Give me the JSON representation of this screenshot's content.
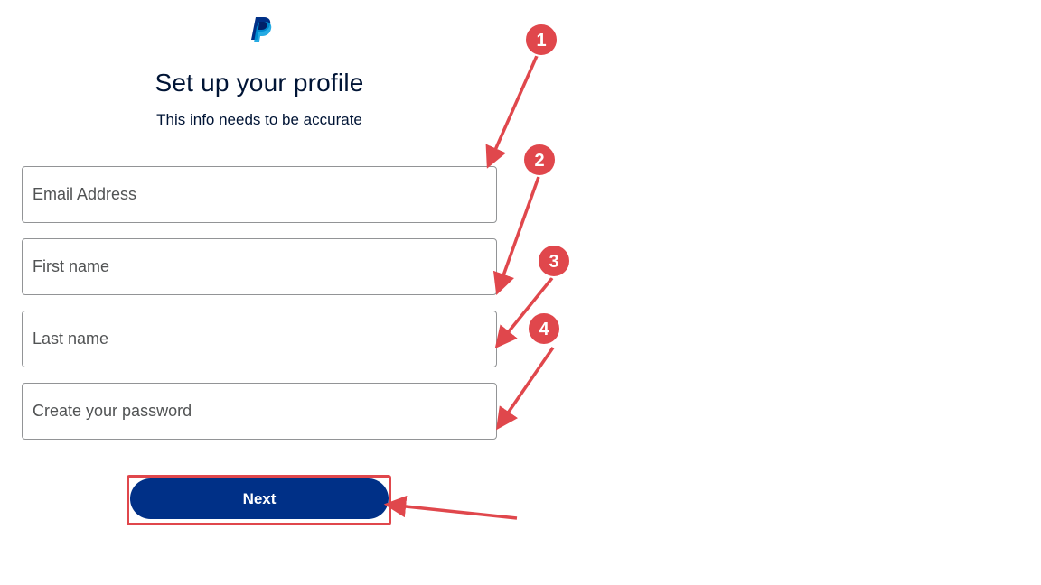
{
  "header": {
    "logo_icon": "paypal-logo-icon",
    "title": "Set up your profile",
    "subtitle": "This info needs to be accurate"
  },
  "form": {
    "email_placeholder": "Email Address",
    "first_name_placeholder": "First name",
    "last_name_placeholder": "Last name",
    "password_placeholder": "Create your password",
    "next_label": "Next"
  },
  "annotations": {
    "markers": [
      "1",
      "2",
      "3",
      "4"
    ],
    "color": "#e0474c"
  },
  "colors": {
    "button": "#003087",
    "text": "#001435",
    "logo_dark": "#003087",
    "logo_light": "#009cde"
  }
}
